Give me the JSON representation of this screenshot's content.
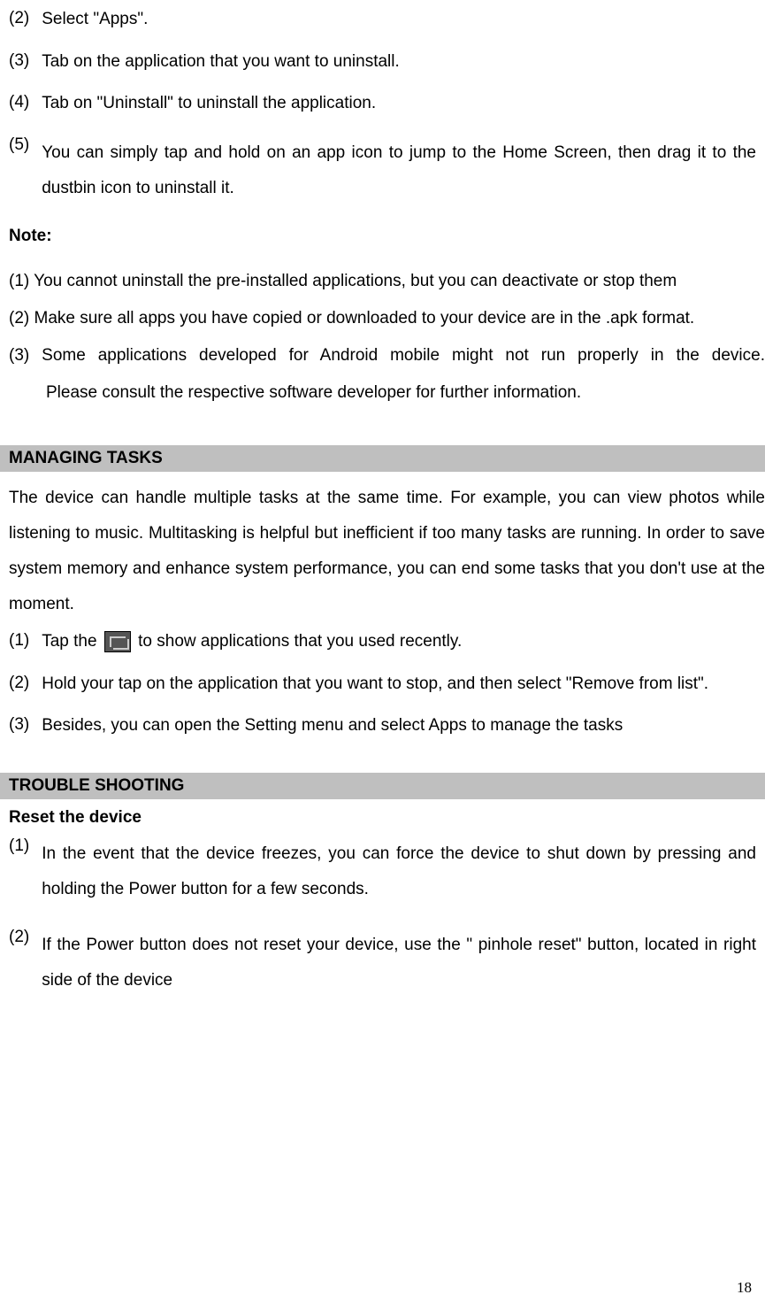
{
  "uninstall_steps": {
    "s2": {
      "num": "(2)",
      "text": "Select \"Apps\"."
    },
    "s3": {
      "num": "(3)",
      "text": "Tab on the application that you want to uninstall."
    },
    "s4": {
      "num": "(4)",
      "text": "Tab on \"Uninstall\" to uninstall the application."
    },
    "s5": {
      "num": "(5)",
      "text": "You can simply tap and hold on an app icon to jump to the Home Screen, then drag it to the dustbin icon to uninstall it."
    }
  },
  "note": {
    "label": "Note:",
    "n1": "(1) You cannot uninstall the pre-installed applications, but you can deactivate or stop them",
    "n2": "(2) Make sure all apps you have copied or downloaded to your device are in the .apk format.",
    "n3_line1": "(3) Some applications developed for Android mobile might not run properly in the device.",
    "n3_line2": "Please consult the respective software developer for further information."
  },
  "managing_tasks": {
    "heading": "MANAGING TASKS",
    "intro": "The device can handle multiple tasks at the same time. For example, you can view photos while listening to music. Multitasking is helpful but inefficient if too many tasks are running. In order to save system memory and enhance system performance, you can end some tasks that you don't use at the moment.",
    "steps": {
      "s1": {
        "num": "(1)",
        "text_before": "Tap the ",
        "text_after": " to show applications that you used recently."
      },
      "s2": {
        "num": "(2)",
        "text": "Hold your tap on the application that you want to stop, and then select \"Remove from list\"."
      },
      "s3": {
        "num": "(3)",
        "text": "Besides, you can open the Setting menu and select Apps to manage the tasks"
      }
    }
  },
  "troubleshooting": {
    "heading": "TROUBLE SHOOTING",
    "subheading": "Reset the device",
    "steps": {
      "s1": {
        "num": "(1)",
        "text": "In the event that the device freezes, you can force the device to shut down by pressing and holding the Power button for a few seconds."
      },
      "s2": {
        "num": "(2)",
        "text": "If the Power button does not reset your device, use the \" pinhole reset\" button, located in right side of the device"
      }
    }
  },
  "page_number": "18"
}
